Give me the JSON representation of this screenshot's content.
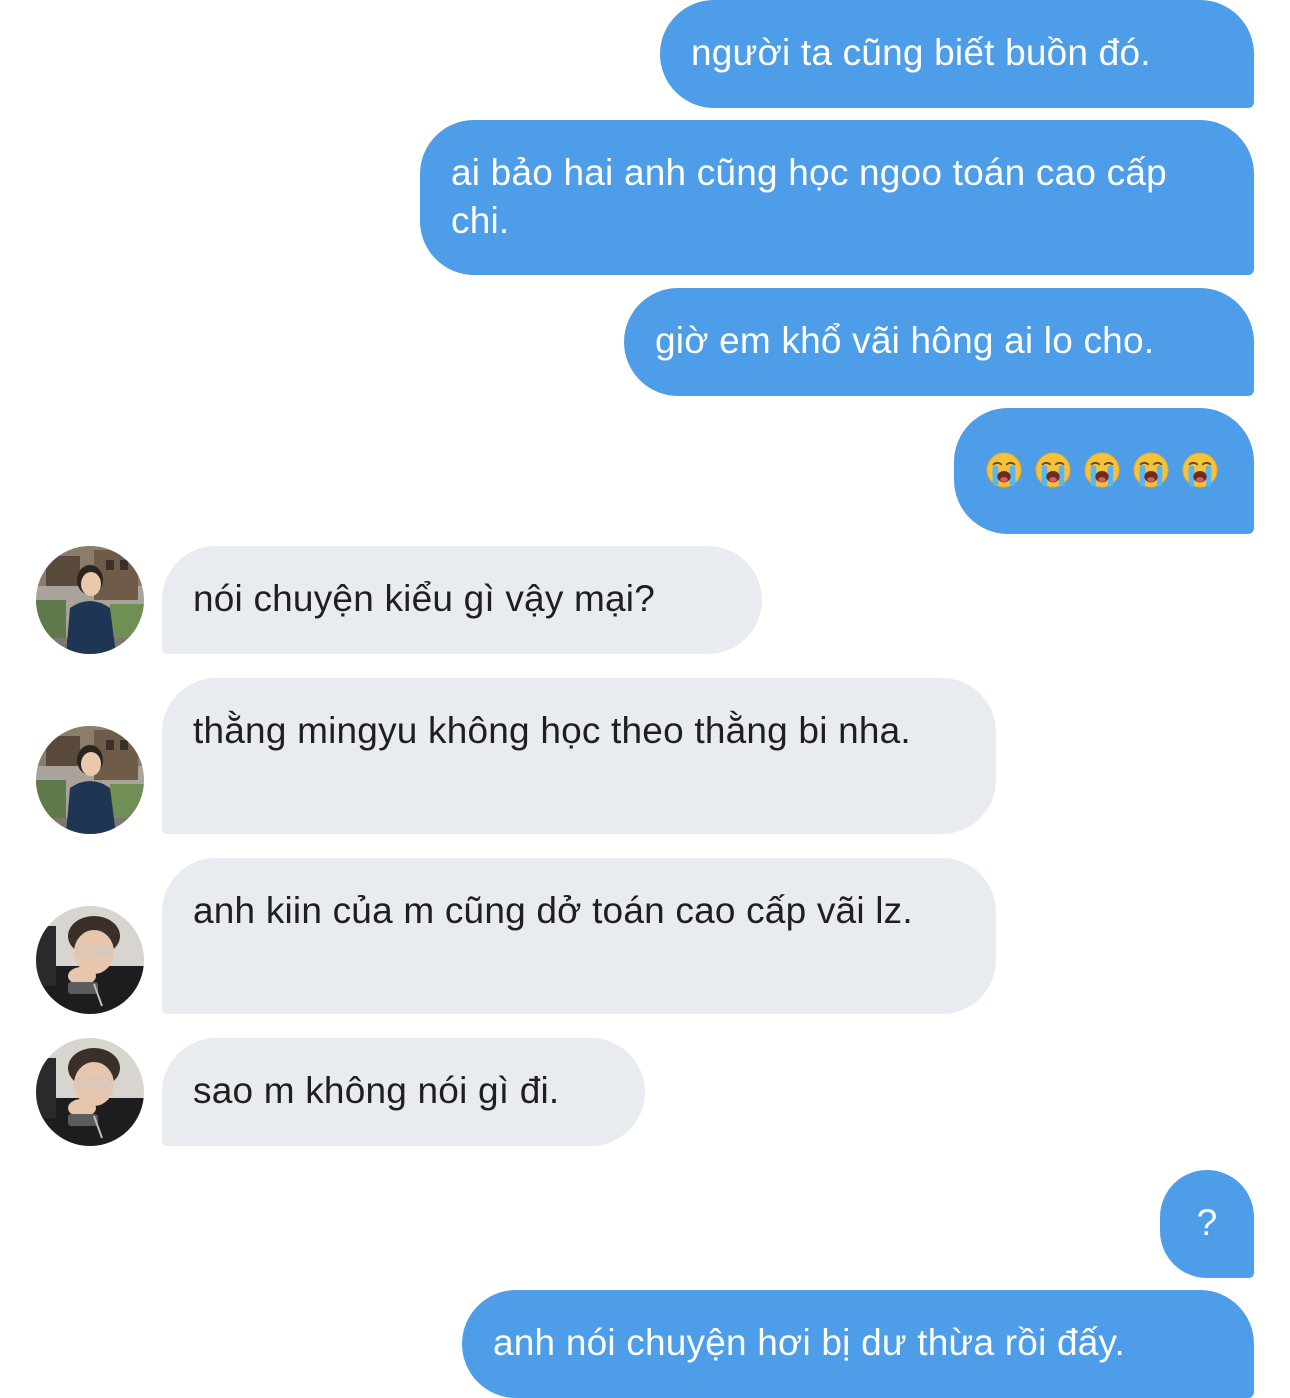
{
  "conversation": {
    "messages": [
      {
        "sender": "me",
        "text": "người ta cũng biết buồn đó."
      },
      {
        "sender": "me",
        "text": "ai bảo hai anh cũng học ngoo toán cao cấp chi."
      },
      {
        "sender": "me",
        "text": "giờ em khổ vãi hông ai lo cho."
      },
      {
        "sender": "me",
        "emoji": [
          "loudly-crying-face",
          "loudly-crying-face",
          "loudly-crying-face",
          "loudly-crying-face",
          "loudly-crying-face"
        ]
      },
      {
        "sender": "contact-1",
        "text": "nói chuyện kiểu gì vậy mại?"
      },
      {
        "sender": "contact-1",
        "text": "thằng mingyu không học theo thằng bi nha."
      },
      {
        "sender": "contact-2",
        "text": "anh kiin của m cũng dở toán cao cấp vãi lz."
      },
      {
        "sender": "contact-2",
        "text": "sao m không nói gì đi."
      },
      {
        "sender": "me",
        "text": "?"
      },
      {
        "sender": "me",
        "text": "anh nói chuyện hơi bị dư thừa rồi đấy."
      }
    ]
  },
  "colors": {
    "outgoing_bubble": "#4d9de9",
    "incoming_bubble": "#e8ebef",
    "outgoing_text": "#ffffff",
    "incoming_text": "#1f1f1f",
    "background": "#ffffff"
  },
  "icons": {
    "avatar_contact_1": "user-avatar-photo",
    "avatar_contact_2": "user-avatar-photo",
    "emoji": "loudly-crying-face"
  }
}
